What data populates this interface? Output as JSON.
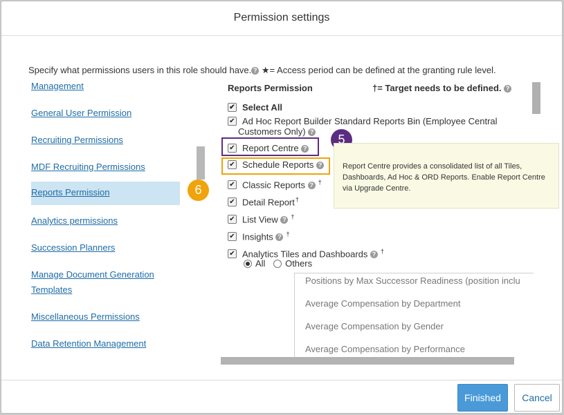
{
  "dialog": {
    "title": "Permission settings",
    "description": "Specify what permissions users in this role should have.",
    "access_note": "★= Access period can be defined at the granting rule level.",
    "help_glyph": "?"
  },
  "nav": {
    "items": [
      {
        "label": "Management"
      },
      {
        "label": "General User Permission"
      },
      {
        "label": "Recruiting Permissions"
      },
      {
        "label": "MDF Recruiting Permissions"
      },
      {
        "label": "Reports Permission"
      },
      {
        "label": "Analytics permissions"
      },
      {
        "label": "Succession Planners"
      },
      {
        "label": "Manage Document Generation"
      },
      {
        "label": "Templates"
      },
      {
        "label": "Miscellaneous Permissions"
      },
      {
        "label": "Data Retention Management"
      }
    ],
    "selected_index": 4
  },
  "badges": {
    "b5": "5",
    "b6": "6"
  },
  "reports": {
    "header": "Reports Permission",
    "target_note": "†= Target needs to be defined.",
    "dagger": "†",
    "checkmark": "✔",
    "select_all": "Select All",
    "adhoc_line1": "Ad Hoc Report Builder Standard Reports Bin (Employee Central",
    "adhoc_line2": "Customers Only)",
    "report_centre": "Report Centre",
    "schedule_reports": "Schedule Reports",
    "classic_reports": "Classic Reports",
    "detail_report": "Detail Report",
    "list_view": "List View",
    "insights": "Insights",
    "analytics_tiles": "Analytics Tiles and Dashboards",
    "radio_all": "All",
    "radio_others": "Others"
  },
  "tooltip": {
    "text": "Report Centre provides a consolidated list of all Tiles, Dashboards, Ad Hoc & ORD Reports. Enable Report Centre via Upgrade Centre."
  },
  "tiles": [
    "Positions by Max Successor Readiness (position inclu",
    "Average Compensation by Department",
    "Average Compensation by Gender",
    "Average Compensation by Performance"
  ],
  "footer": {
    "finished": "Finished",
    "cancel": "Cancel"
  },
  "colors": {
    "accent_blue": "#4a9ad9",
    "link_blue": "#1f6ca8",
    "badge_purple": "#5a2c83",
    "badge_orange": "#f0a30a",
    "selected_bg": "#cde4f2"
  }
}
